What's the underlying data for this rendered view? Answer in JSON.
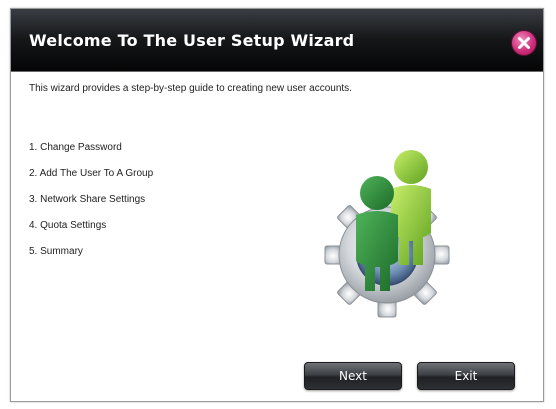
{
  "dialog": {
    "title": "Welcome To The User Setup Wizard",
    "intro": "This wizard provides a step-by-step guide to creating new user accounts.",
    "steps": [
      "1. Change Password",
      "2. Add The User To A Group",
      "3. Network Share Settings",
      "4. Quota Settings",
      "5. Summary"
    ],
    "buttons": {
      "next": "Next",
      "exit": "Exit"
    },
    "icons": {
      "close": "close-icon",
      "illustration": "users-gear-icon"
    }
  },
  "colors": {
    "title_bar": "#0c0d0f",
    "close_button": "#cf2f7c",
    "button": "#2d3034",
    "person_dark": "#2f8a3a",
    "person_light": "#8ec83a",
    "gear": "#c9cdd2"
  }
}
